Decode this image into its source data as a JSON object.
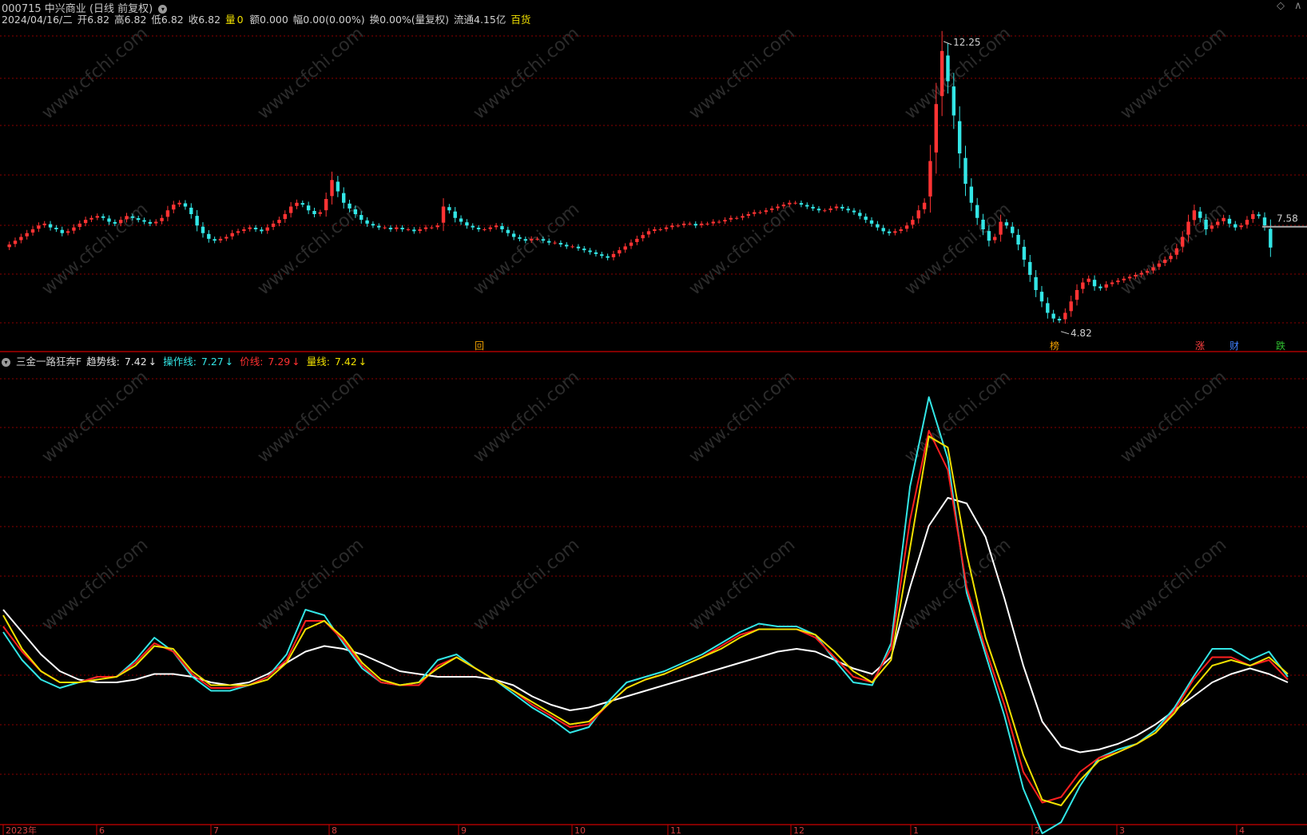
{
  "header": {
    "code": "000715",
    "name": "中兴商业",
    "period": "(日线 前复权)",
    "date": "2024/04/16/二",
    "open": "开6.82",
    "high": "高6.82",
    "low": "低6.82",
    "close": "收6.82",
    "volume_label": "量",
    "volume_value": "0",
    "amount": "额0.000",
    "range": "幅0.00(0.00%)",
    "turnover": "换0.00%(量复权)",
    "float_cap": "流通4.15亿",
    "sector": "百货"
  },
  "indicator": {
    "name": "三金一路狂奔F",
    "trend_label": "趋势线:",
    "trend_value": "7.42",
    "op_label": "操作线:",
    "op_value": "7.27",
    "price_label": "价线:",
    "price_value": "7.29",
    "vol_label": "量线:",
    "vol_value": "7.42",
    "arrow": "↓"
  },
  "price_annotations": {
    "high_label": "12.25",
    "low_label": "4.82",
    "current_label": "7.58"
  },
  "event_markers": [
    {
      "text": "回",
      "color": "#f0a000"
    },
    {
      "text": "榜",
      "color": "#f0a000"
    },
    {
      "text": "涨",
      "color": "#ff4040"
    },
    {
      "text": "财",
      "color": "#4080ff"
    },
    {
      "text": "跌",
      "color": "#30c030"
    }
  ],
  "x_axis_labels": [
    "2023年",
    "6",
    "7",
    "8",
    "9",
    "10",
    "11",
    "12",
    "1",
    "2",
    "3",
    "4"
  ],
  "watermark": "www.cfchi.com",
  "colors": {
    "up": "#ff3333",
    "down": "#33e6e6",
    "grid": "#8b0000",
    "frame": "#cc0000",
    "trend": "#ffffff",
    "op": "#33e6e6",
    "price": "#ff2020",
    "vol": "#f0e000"
  },
  "chart_data": [
    {
      "type": "candlestick",
      "title": "000715 中兴商业 (日线 前复权)",
      "xlabel": "",
      "ylabel": "",
      "x_range": [
        "2023-05",
        "2024-04-16"
      ],
      "ylim": [
        4.5,
        12.5
      ],
      "grid": true,
      "close_series": [
        6.9,
        7.0,
        7.1,
        7.2,
        7.3,
        7.4,
        7.45,
        7.35,
        7.3,
        7.2,
        7.25,
        7.35,
        7.45,
        7.55,
        7.6,
        7.65,
        7.6,
        7.5,
        7.45,
        7.55,
        7.65,
        7.6,
        7.55,
        7.5,
        7.45,
        7.5,
        7.6,
        7.8,
        7.95,
        8.0,
        7.9,
        7.7,
        7.4,
        7.2,
        7.05,
        7.0,
        7.05,
        7.1,
        7.2,
        7.25,
        7.3,
        7.35,
        7.3,
        7.25,
        7.35,
        7.45,
        7.55,
        7.7,
        7.9,
        8.0,
        7.95,
        7.8,
        7.7,
        7.75,
        8.1,
        8.6,
        8.3,
        8.0,
        7.85,
        7.7,
        7.55,
        7.45,
        7.4,
        7.35,
        7.35,
        7.3,
        7.35,
        7.3,
        7.3,
        7.25,
        7.3,
        7.35,
        7.35,
        7.4,
        7.9,
        7.8,
        7.6,
        7.5,
        7.4,
        7.35,
        7.3,
        7.3,
        7.35,
        7.4,
        7.3,
        7.2,
        7.1,
        7.05,
        7.0,
        7.05,
        7.05,
        7.0,
        6.95,
        6.95,
        6.9,
        6.85,
        6.85,
        6.8,
        6.75,
        6.7,
        6.65,
        6.6,
        6.55,
        6.65,
        6.75,
        6.85,
        6.95,
        7.05,
        7.15,
        7.25,
        7.3,
        7.3,
        7.35,
        7.4,
        7.4,
        7.45,
        7.45,
        7.4,
        7.45,
        7.45,
        7.5,
        7.5,
        7.55,
        7.6,
        7.6,
        7.65,
        7.7,
        7.75,
        7.75,
        7.8,
        7.85,
        7.9,
        7.95,
        8.0,
        8.0,
        7.95,
        7.9,
        7.85,
        7.8,
        7.8,
        7.85,
        7.9,
        7.85,
        7.8,
        7.75,
        7.65,
        7.55,
        7.45,
        7.35,
        7.25,
        7.2,
        7.25,
        7.3,
        7.4,
        7.55,
        7.8,
        8.0,
        9.1,
        10.6,
        12.0,
        11.2,
        10.3,
        9.3,
        8.5,
        8.0,
        7.6,
        7.3,
        7.0,
        7.1,
        7.5,
        7.4,
        7.2,
        6.9,
        6.5,
        6.1,
        5.7,
        5.4,
        5.1,
        4.95,
        4.9,
        5.1,
        5.4,
        5.7,
        5.9,
        6.0,
        5.8,
        5.75,
        5.85,
        5.9,
        5.95,
        6.0,
        6.05,
        6.1,
        6.15,
        6.2,
        6.3,
        6.4,
        6.5,
        6.6,
        6.8,
        7.1,
        7.5,
        7.8,
        7.6,
        7.3,
        7.4,
        7.5,
        7.6,
        7.45,
        7.35,
        7.4,
        7.55,
        7.7,
        7.65,
        7.4,
        6.82
      ]
    },
    {
      "type": "line",
      "title": "三金一路狂奔F",
      "xlabel": "",
      "ylabel": "",
      "ylim": [
        4.5,
        12.5
      ],
      "grid": true,
      "series": [
        {
          "name": "趋势线",
          "color": "#ffffff",
          "values": [
            8.2,
            7.8,
            7.4,
            7.1,
            6.95,
            6.9,
            6.9,
            6.95,
            7.05,
            7.05,
            7.0,
            6.9,
            6.85,
            6.9,
            7.05,
            7.25,
            7.45,
            7.55,
            7.5,
            7.4,
            7.25,
            7.1,
            7.05,
            7.0,
            7.0,
            7.0,
            6.95,
            6.85,
            6.65,
            6.5,
            6.4,
            6.45,
            6.55,
            6.65,
            6.75,
            6.85,
            6.95,
            7.05,
            7.15,
            7.25,
            7.35,
            7.45,
            7.5,
            7.45,
            7.3,
            7.15,
            7.05,
            7.35,
            8.6,
            9.7,
            10.2,
            10.1,
            9.5,
            8.4,
            7.2,
            6.2,
            5.75,
            5.65,
            5.7,
            5.8,
            5.95,
            6.15,
            6.4,
            6.65,
            6.9,
            7.05,
            7.15,
            7.05,
            6.9
          ]
        },
        {
          "name": "操作线",
          "color": "#33e6e6",
          "values": [
            7.8,
            7.3,
            6.95,
            6.8,
            6.9,
            7.0,
            7.0,
            7.3,
            7.7,
            7.45,
            7.0,
            6.75,
            6.75,
            6.85,
            7.0,
            7.4,
            8.2,
            8.1,
            7.6,
            7.15,
            6.9,
            6.85,
            6.9,
            7.3,
            7.4,
            7.15,
            6.95,
            6.7,
            6.45,
            6.25,
            6.0,
            6.1,
            6.55,
            6.9,
            7.0,
            7.1,
            7.25,
            7.4,
            7.6,
            7.8,
            7.95,
            7.9,
            7.9,
            7.75,
            7.3,
            6.9,
            6.85,
            7.6,
            10.4,
            12.0,
            10.9,
            8.5,
            7.4,
            6.3,
            5.0,
            4.2,
            4.4,
            5.05,
            5.55,
            5.7,
            5.8,
            6.05,
            6.45,
            7.0,
            7.5,
            7.5,
            7.3,
            7.45,
            7.0
          ]
        },
        {
          "name": "价线",
          "color": "#ff2020",
          "values": [
            7.9,
            7.45,
            7.1,
            6.9,
            6.9,
            7.0,
            7.0,
            7.25,
            7.6,
            7.45,
            7.05,
            6.8,
            6.8,
            6.85,
            7.0,
            7.3,
            8.0,
            8.0,
            7.65,
            7.2,
            6.9,
            6.85,
            6.85,
            7.2,
            7.35,
            7.15,
            6.95,
            6.75,
            6.5,
            6.3,
            6.1,
            6.15,
            6.5,
            6.8,
            6.95,
            7.05,
            7.2,
            7.35,
            7.55,
            7.75,
            7.85,
            7.85,
            7.85,
            7.7,
            7.35,
            7.0,
            6.9,
            7.5,
            9.8,
            11.4,
            10.7,
            8.6,
            7.5,
            6.5,
            5.3,
            4.75,
            4.85,
            5.3,
            5.55,
            5.65,
            5.8,
            6.0,
            6.4,
            6.95,
            7.35,
            7.35,
            7.2,
            7.3,
            6.95
          ]
        },
        {
          "name": "量线",
          "color": "#f0e000",
          "values": [
            8.1,
            7.5,
            7.1,
            6.9,
            6.9,
            6.95,
            7.0,
            7.2,
            7.55,
            7.5,
            7.1,
            6.85,
            6.85,
            6.85,
            6.95,
            7.25,
            7.85,
            8.0,
            7.7,
            7.25,
            6.95,
            6.85,
            6.9,
            7.15,
            7.35,
            7.15,
            6.95,
            6.75,
            6.55,
            6.35,
            6.15,
            6.2,
            6.5,
            6.8,
            6.95,
            7.05,
            7.2,
            7.35,
            7.5,
            7.7,
            7.85,
            7.85,
            7.85,
            7.75,
            7.45,
            7.1,
            6.9,
            7.3,
            9.3,
            11.3,
            11.1,
            9.2,
            7.7,
            6.7,
            5.6,
            4.8,
            4.7,
            5.15,
            5.5,
            5.65,
            5.8,
            6.0,
            6.35,
            6.8,
            7.2,
            7.3,
            7.2,
            7.35,
            7.05
          ]
        }
      ]
    }
  ]
}
